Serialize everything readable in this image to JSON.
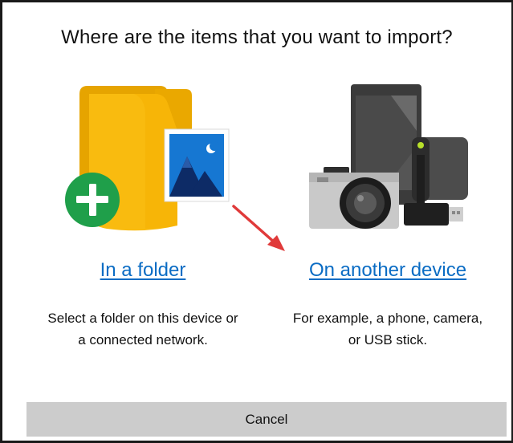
{
  "dialog": {
    "title": "Where are the items that you want to import?"
  },
  "options": {
    "folder": {
      "link_label": "In a folder",
      "description_line1": "Select a folder on this device or",
      "description_line2": "a connected network."
    },
    "device": {
      "link_label": "On another device",
      "description_line1": "For example, a phone, camera,",
      "description_line2": "or USB stick."
    }
  },
  "footer": {
    "cancel_label": "Cancel"
  },
  "icons": {
    "folder_illustration": "folder-with-photo-and-plus-icon",
    "device_illustration": "phone-camera-usb-icon",
    "annotation_arrow": "red-arrow-icon"
  },
  "colors": {
    "link": "#0a6cc4",
    "folder_yellow": "#f9b700",
    "plus_green": "#1f9f4a",
    "cancel_bg": "#cccccc",
    "arrow_red": "#e03a3a"
  }
}
